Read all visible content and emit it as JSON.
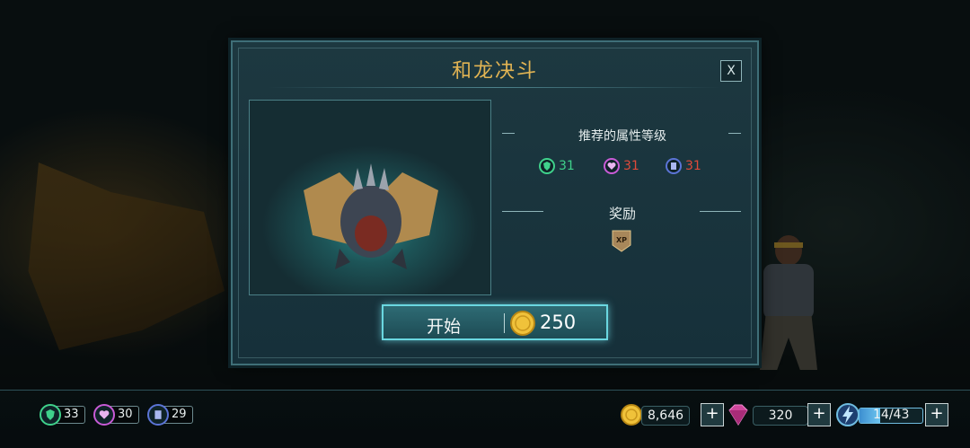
{
  "dialog": {
    "title": "和龙决斗",
    "close_label": "X",
    "recommended_label": "推荐的属性等级",
    "recommended_stats": [
      {
        "icon": "shield-icon",
        "value": "31",
        "color": "#3fd18b"
      },
      {
        "icon": "heart-icon",
        "value": "31",
        "color": "#c85bd6"
      },
      {
        "icon": "book-icon",
        "value": "31",
        "color": "#5b74d6"
      }
    ],
    "reward_label": "奖励",
    "reward_icon": "xp-badge-icon",
    "reward_text": "XP",
    "start_label": "开始",
    "start_cost": "250"
  },
  "hud": {
    "stats": [
      {
        "icon": "shield-icon",
        "value": "33",
        "color": "#3fd18b"
      },
      {
        "icon": "heart-icon",
        "value": "30",
        "color": "#c85bd6"
      },
      {
        "icon": "book-icon",
        "value": "29",
        "color": "#5b74d6"
      }
    ],
    "coins": "8,646",
    "gems": "320",
    "energy_text": "14/43",
    "energy_fraction": 0.326,
    "plus_label": "+"
  },
  "colors": {
    "title_gold": "#e2b453",
    "green_value": "#3fd18b",
    "red_value": "#e04a3a",
    "accent_cyan": "#6ad7e0"
  }
}
